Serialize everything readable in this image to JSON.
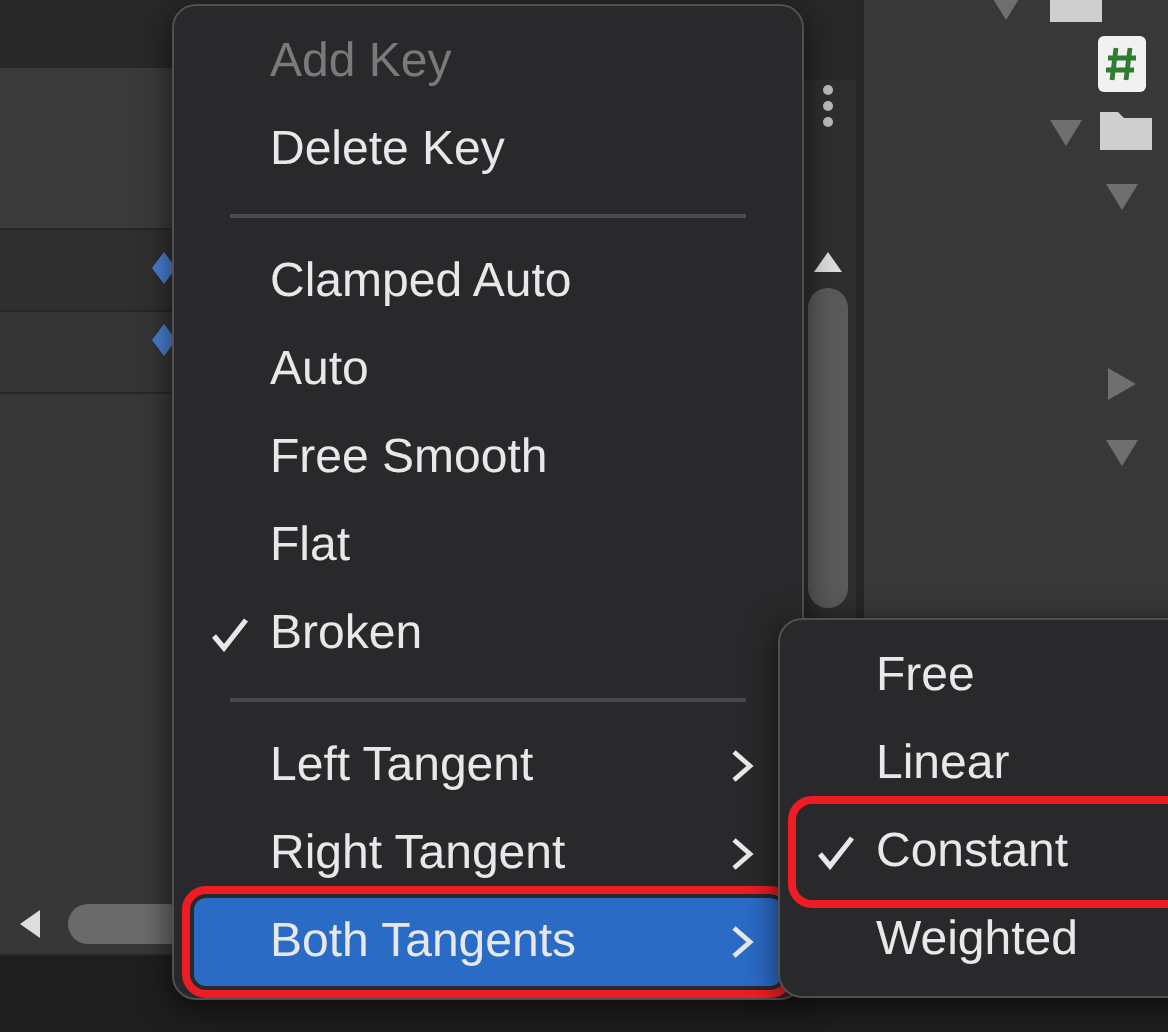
{
  "menu": {
    "items": [
      {
        "kind": "item",
        "label": "Add Key",
        "disabled": true,
        "checked": false,
        "selected": false,
        "submenu": false,
        "annotated": false
      },
      {
        "kind": "item",
        "label": "Delete Key",
        "disabled": false,
        "checked": false,
        "selected": false,
        "submenu": false,
        "annotated": false
      },
      {
        "kind": "separator"
      },
      {
        "kind": "item",
        "label": "Clamped Auto",
        "disabled": false,
        "checked": false,
        "selected": false,
        "submenu": false,
        "annotated": false
      },
      {
        "kind": "item",
        "label": "Auto",
        "disabled": false,
        "checked": false,
        "selected": false,
        "submenu": false,
        "annotated": false
      },
      {
        "kind": "item",
        "label": "Free Smooth",
        "disabled": false,
        "checked": false,
        "selected": false,
        "submenu": false,
        "annotated": false
      },
      {
        "kind": "item",
        "label": "Flat",
        "disabled": false,
        "checked": false,
        "selected": false,
        "submenu": false,
        "annotated": false
      },
      {
        "kind": "item",
        "label": "Broken",
        "disabled": false,
        "checked": true,
        "selected": false,
        "submenu": false,
        "annotated": false
      },
      {
        "kind": "separator"
      },
      {
        "kind": "item",
        "label": "Left Tangent",
        "disabled": false,
        "checked": false,
        "selected": false,
        "submenu": true,
        "annotated": false
      },
      {
        "kind": "item",
        "label": "Right Tangent",
        "disabled": false,
        "checked": false,
        "selected": false,
        "submenu": true,
        "annotated": false
      },
      {
        "kind": "item",
        "label": "Both Tangents",
        "disabled": false,
        "checked": false,
        "selected": true,
        "submenu": true,
        "annotated": true
      }
    ]
  },
  "submenu": {
    "items": [
      {
        "kind": "item",
        "label": "Free",
        "disabled": false,
        "checked": false,
        "selected": false,
        "submenu": false,
        "annotated": false
      },
      {
        "kind": "item",
        "label": "Linear",
        "disabled": false,
        "checked": false,
        "selected": false,
        "submenu": false,
        "annotated": false
      },
      {
        "kind": "item",
        "label": "Constant",
        "disabled": false,
        "checked": true,
        "selected": false,
        "submenu": false,
        "annotated": true
      },
      {
        "kind": "item",
        "label": "Weighted",
        "disabled": false,
        "checked": false,
        "selected": false,
        "submenu": false,
        "annotated": false
      }
    ]
  }
}
